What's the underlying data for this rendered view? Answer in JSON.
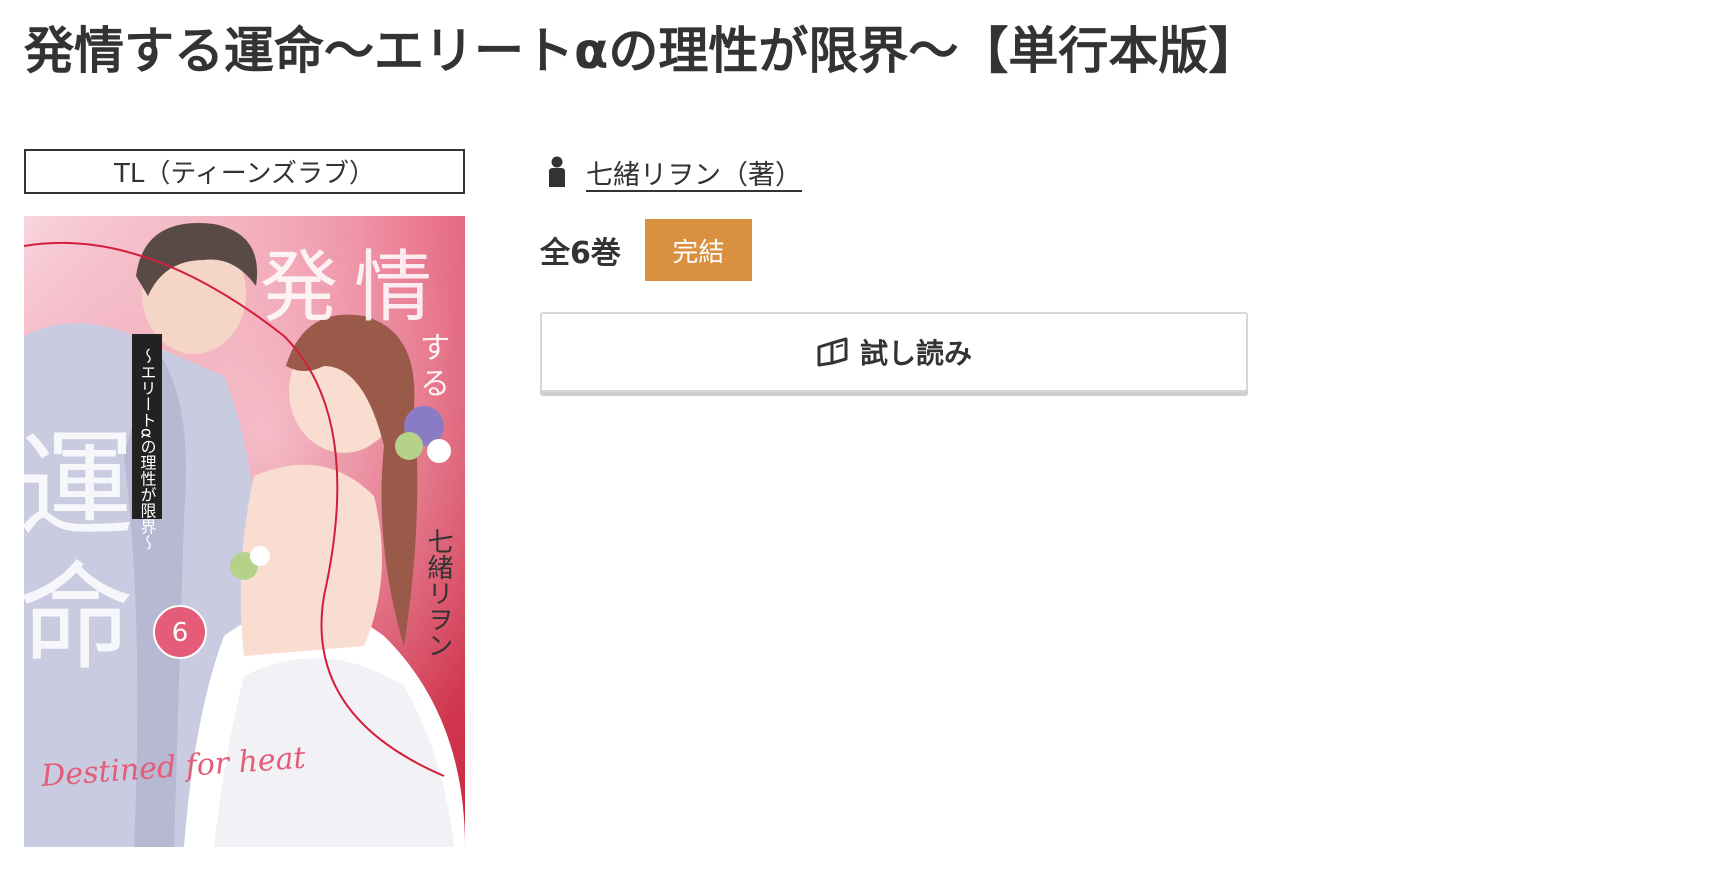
{
  "book": {
    "title": "発情する運命〜エリートαの理性が限界〜【単行本版】",
    "genre": "TL（ティーンズラブ）",
    "author": "七緒リヲン（著）",
    "volume_count": "全6巻",
    "status": "完結",
    "trial_read_label": "試し読み"
  },
  "cover": {
    "title_chars": [
      "発",
      "情",
      "す",
      "る",
      "運",
      "命"
    ],
    "subtitle": "〜エリートαの理性が限界〜",
    "author": "七緒リヲン",
    "volume_number": "6",
    "english_title": "Destined for heat"
  },
  "colors": {
    "status_badge": "#d9913f",
    "text": "#333333",
    "button_border": "#d6d6d6"
  },
  "icons": {
    "author": "person-icon",
    "trial_read": "open-book-icon"
  }
}
